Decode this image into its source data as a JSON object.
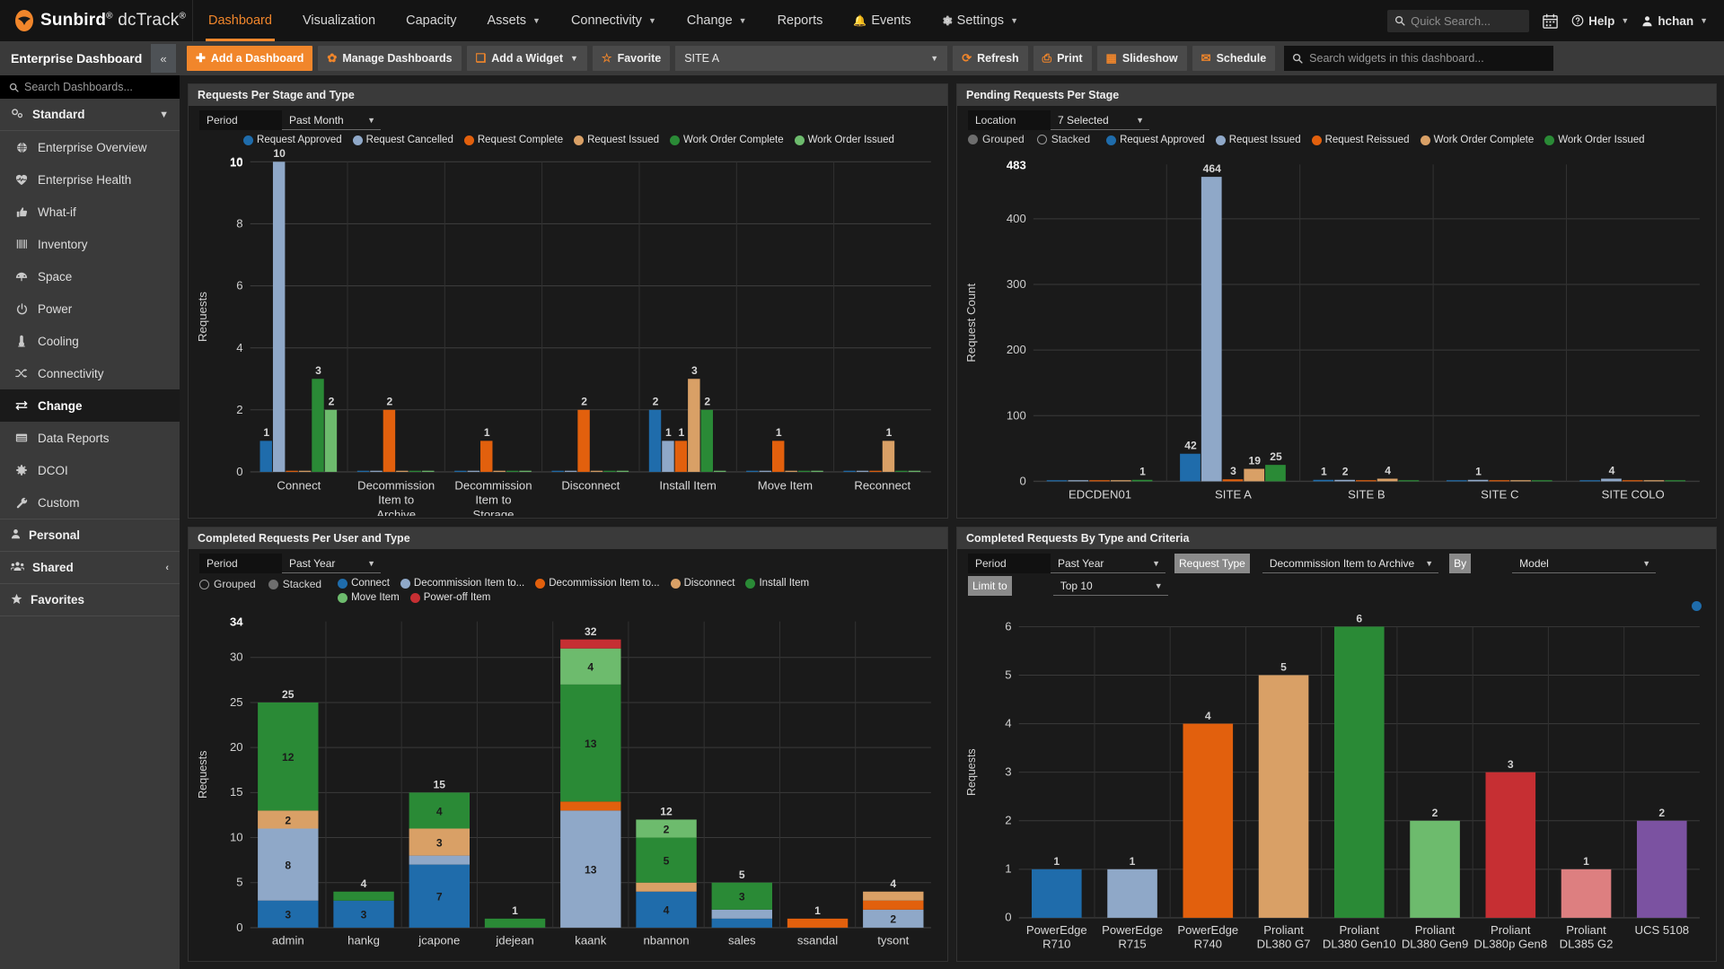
{
  "topbar": {
    "brand_bold": "Sunbird",
    "brand_light": "dcTrack",
    "nav": [
      {
        "label": "Dashboard",
        "active": true,
        "caret": false,
        "icon": ""
      },
      {
        "label": "Visualization",
        "active": false,
        "caret": false,
        "icon": ""
      },
      {
        "label": "Capacity",
        "active": false,
        "caret": false,
        "icon": ""
      },
      {
        "label": "Assets",
        "active": false,
        "caret": true,
        "icon": ""
      },
      {
        "label": "Connectivity",
        "active": false,
        "caret": true,
        "icon": ""
      },
      {
        "label": "Change",
        "active": false,
        "caret": true,
        "icon": ""
      },
      {
        "label": "Reports",
        "active": false,
        "caret": false,
        "icon": ""
      },
      {
        "label": "Events",
        "active": false,
        "caret": false,
        "icon": "bell-icon"
      },
      {
        "label": "Settings",
        "active": false,
        "caret": true,
        "icon": "gear-icon"
      }
    ],
    "quick_search_placeholder": "Quick Search...",
    "calendar_icon": "calendar-icon",
    "help_label": "Help",
    "user_label": "hchan"
  },
  "sidebar": {
    "title": "Enterprise Dashboard",
    "collapse_icon": "chevron-double-left-icon",
    "search_placeholder": "Search Dashboards...",
    "group_standard": "Standard",
    "items": [
      {
        "label": "Enterprise Overview",
        "icon": "globe-icon"
      },
      {
        "label": "Enterprise Health",
        "icon": "heartbeat-icon"
      },
      {
        "label": "What-if",
        "icon": "thumbs-up-icon"
      },
      {
        "label": "Inventory",
        "icon": "barcode-icon"
      },
      {
        "label": "Space",
        "icon": "dashboard-gauge-icon"
      },
      {
        "label": "Power",
        "icon": "power-icon"
      },
      {
        "label": "Cooling",
        "icon": "thermometer-icon"
      },
      {
        "label": "Connectivity",
        "icon": "shuffle-icon"
      },
      {
        "label": "Change",
        "icon": "exchange-icon",
        "selected": true
      },
      {
        "label": "Data Reports",
        "icon": "table-icon"
      },
      {
        "label": "DCOI",
        "icon": "asterisk-icon"
      },
      {
        "label": "Custom",
        "icon": "wrench-icon"
      }
    ],
    "footer_groups": [
      {
        "label": "Personal",
        "icon": "user-icon",
        "chev": ""
      },
      {
        "label": "Shared",
        "icon": "users-icon",
        "chev": "‹"
      },
      {
        "label": "Favorites",
        "icon": "star-icon",
        "chev": ""
      }
    ]
  },
  "toolbar": {
    "add_dashboard": "Add a Dashboard",
    "manage_dashboards": "Manage Dashboards",
    "add_widget": "Add a Widget",
    "favorite": "Favorite",
    "site_select": "SITE A",
    "refresh": "Refresh",
    "print": "Print",
    "slideshow": "Slideshow",
    "schedule": "Schedule",
    "search_placeholder": "Search widgets in this dashboard..."
  },
  "widgets": {
    "w1": {
      "title": "Requests Per Stage and Type",
      "period_label": "Period",
      "period_value": "Past Month"
    },
    "w2": {
      "title": "Pending Requests Per Stage",
      "location_label": "Location",
      "location_value": "7 Selected",
      "grouped_label": "Grouped",
      "stacked_label": "Stacked",
      "mode": "grouped"
    },
    "w3": {
      "title": "Completed Requests Per User and Type",
      "period_label": "Period",
      "period_value": "Past Year",
      "grouped_label": "Grouped",
      "stacked_label": "Stacked",
      "mode": "stacked"
    },
    "w4": {
      "title": "Completed Requests By Type and Criteria",
      "period_label": "Period",
      "period_value": "Past Year",
      "request_type_label": "Request Type",
      "request_type_value": "Decommission Item to Archive",
      "by_label": "By",
      "by_value": "Model",
      "limit_label": "Limit to",
      "limit_value": "Top 10"
    }
  },
  "chart_data": [
    {
      "id": "requests-per-stage-and-type",
      "type": "bar",
      "title": "Requests Per Stage and Type",
      "xlabel": "",
      "ylabel": "Requests",
      "ylim": [
        0,
        10
      ],
      "yticks": [
        0,
        2,
        4,
        6,
        8,
        10
      ],
      "ymax_label": "10",
      "grid": true,
      "grouping": "grouped",
      "categories": [
        "Connect",
        "Decommission Item to Archive",
        "Decommission Item to Storage",
        "Disconnect",
        "Install Item",
        "Move Item",
        "Reconnect"
      ],
      "series": [
        {
          "name": "Request Approved",
          "color": "#1f6cab",
          "values": [
            1,
            0,
            0,
            0,
            2,
            0,
            0
          ]
        },
        {
          "name": "Request Cancelled",
          "color": "#8fa8c8",
          "values": [
            10,
            0,
            0,
            0,
            1,
            0,
            0
          ]
        },
        {
          "name": "Request Complete",
          "color": "#e2600d",
          "values": [
            0,
            2,
            1,
            2,
            1,
            1,
            0
          ]
        },
        {
          "name": "Request Issued",
          "color": "#d9a066",
          "values": [
            0,
            0,
            0,
            0,
            3,
            0,
            1
          ]
        },
        {
          "name": "Work Order Complete",
          "color": "#2a8a36",
          "values": [
            3,
            0,
            0,
            0,
            2,
            0,
            0
          ]
        },
        {
          "name": "Work Order Issued",
          "color": "#6dbb6d",
          "values": [
            2,
            0,
            0,
            0,
            0,
            0,
            0
          ]
        }
      ]
    },
    {
      "id": "pending-requests-per-stage",
      "type": "bar",
      "title": "Pending Requests Per Stage",
      "xlabel": "",
      "ylabel": "Request Count",
      "ylim": [
        0,
        483
      ],
      "yticks": [
        0,
        100,
        200,
        300,
        400
      ],
      "ymax_label": "483",
      "grid": true,
      "grouping": "grouped",
      "categories": [
        "EDCDEN01",
        "SITE A",
        "SITE B",
        "SITE C",
        "SITE COLO"
      ],
      "series": [
        {
          "name": "Request Approved",
          "color": "#1f6cab",
          "values": [
            0,
            42,
            1,
            0,
            0
          ]
        },
        {
          "name": "Request Issued",
          "color": "#8fa8c8",
          "values": [
            0,
            464,
            2,
            1,
            4
          ]
        },
        {
          "name": "Request Reissued",
          "color": "#e2600d",
          "values": [
            0,
            3,
            0,
            0,
            0
          ]
        },
        {
          "name": "Work Order Complete",
          "color": "#d9a066",
          "values": [
            0,
            19,
            4,
            0,
            0
          ]
        },
        {
          "name": "Work Order Issued",
          "color": "#2a8a36",
          "values": [
            1,
            25,
            0,
            0,
            0
          ]
        }
      ]
    },
    {
      "id": "completed-requests-per-user-and-type",
      "type": "bar",
      "title": "Completed Requests Per User and Type",
      "xlabel": "",
      "ylabel": "Requests",
      "ylim": [
        0,
        34
      ],
      "yticks": [
        0,
        5,
        10,
        15,
        20,
        25,
        30
      ],
      "ymax_label": "34",
      "grid": true,
      "grouping": "stacked",
      "categories": [
        "admin",
        "hankg",
        "jcapone",
        "jdejean",
        "kaank",
        "nbannon",
        "sales",
        "ssandal",
        "tysont"
      ],
      "totals": [
        25,
        4,
        15,
        1,
        32,
        12,
        5,
        1,
        4
      ],
      "series": [
        {
          "name": "Connect",
          "color": "#1f6cab",
          "values": [
            3,
            3,
            7,
            0,
            0,
            4,
            1,
            0,
            0
          ]
        },
        {
          "name": "Decommission Item to...",
          "color": "#8fa8c8",
          "values": [
            8,
            0,
            1,
            0,
            13,
            0,
            1,
            0,
            2
          ]
        },
        {
          "name": "Decommission Item to...",
          "color": "#e2600d",
          "values": [
            0,
            0,
            0,
            0,
            1,
            0,
            0,
            1,
            1
          ]
        },
        {
          "name": "Disconnect",
          "color": "#d9a066",
          "values": [
            2,
            0,
            3,
            0,
            0,
            1,
            0,
            0,
            1
          ]
        },
        {
          "name": "Install Item",
          "color": "#2a8a36",
          "values": [
            12,
            1,
            4,
            1,
            13,
            5,
            3,
            0,
            0
          ]
        },
        {
          "name": "Move Item",
          "color": "#6dbb6d",
          "values": [
            0,
            0,
            0,
            0,
            4,
            2,
            0,
            0,
            0
          ]
        },
        {
          "name": "Power-off Item",
          "color": "#c62f33",
          "values": [
            0,
            0,
            0,
            0,
            1,
            0,
            0,
            0,
            0
          ]
        }
      ]
    },
    {
      "id": "completed-requests-by-type-and-criteria",
      "type": "bar",
      "title": "Completed Requests By Type and Criteria",
      "xlabel": "",
      "ylabel": "Requests",
      "ylim": [
        0,
        6
      ],
      "yticks": [
        0,
        1,
        2,
        3,
        4,
        5,
        6
      ],
      "grid": true,
      "grouping": "single",
      "categories": [
        "PowerEdge R710",
        "PowerEdge R715",
        "PowerEdge R740",
        "Proliant DL380 G7",
        "Proliant DL380 Gen10",
        "Proliant DL380 Gen9",
        "Proliant DL380p Gen8",
        "Proliant DL385 G2",
        "UCS 5108"
      ],
      "values": [
        1,
        1,
        4,
        5,
        6,
        2,
        3,
        1,
        2
      ],
      "colors": [
        "#1f6cab",
        "#8fa8c8",
        "#e2600d",
        "#d9a066",
        "#2a8a36",
        "#6dbb6d",
        "#c62f33",
        "#dd7f80",
        "#7b52a1"
      ]
    }
  ]
}
